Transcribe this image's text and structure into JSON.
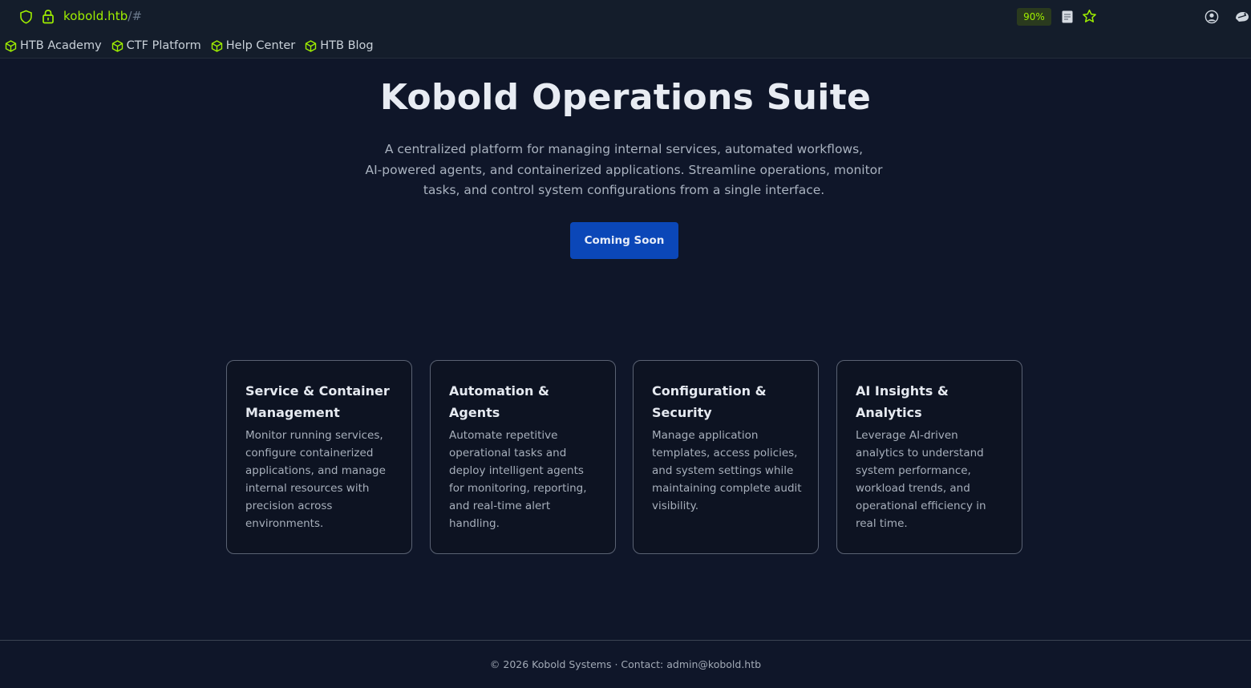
{
  "browser": {
    "url_host": "kobold.htb",
    "url_path": "/#",
    "zoom": "90%",
    "bookmarks": [
      {
        "label": "HTB Academy"
      },
      {
        "label": "CTF Platform"
      },
      {
        "label": "Help Center"
      },
      {
        "label": "HTB Blog"
      }
    ],
    "accent_color": "#9fef00"
  },
  "hero": {
    "title": "Kobold Operations Suite",
    "description_lines": [
      "A centralized platform for managing internal services, automated workflows,",
      "AI-powered agents, and containerized applications. Streamline operations, monitor",
      "tasks, and control system configurations from a single interface."
    ],
    "cta_label": "Coming Soon",
    "cta_color": "#0b47b8"
  },
  "features": [
    {
      "title": "Service & Container Management",
      "text": "Monitor running services, configure containerized applications, and manage internal resources with precision across environments."
    },
    {
      "title": "Automation & Agents",
      "text": "Automate repetitive operational tasks and deploy intelligent agents for monitoring, reporting, and real-time alert handling."
    },
    {
      "title": "Configuration & Security",
      "text": "Manage application templates, access policies, and system settings while maintaining complete audit visibility."
    },
    {
      "title": "AI Insights & Analytics",
      "text": "Leverage AI-driven analytics to understand system performance, workload trends, and operational efficiency in real time."
    }
  ],
  "footer": {
    "text": "© 2026 Kobold Systems · Contact: admin@kobold.htb"
  }
}
